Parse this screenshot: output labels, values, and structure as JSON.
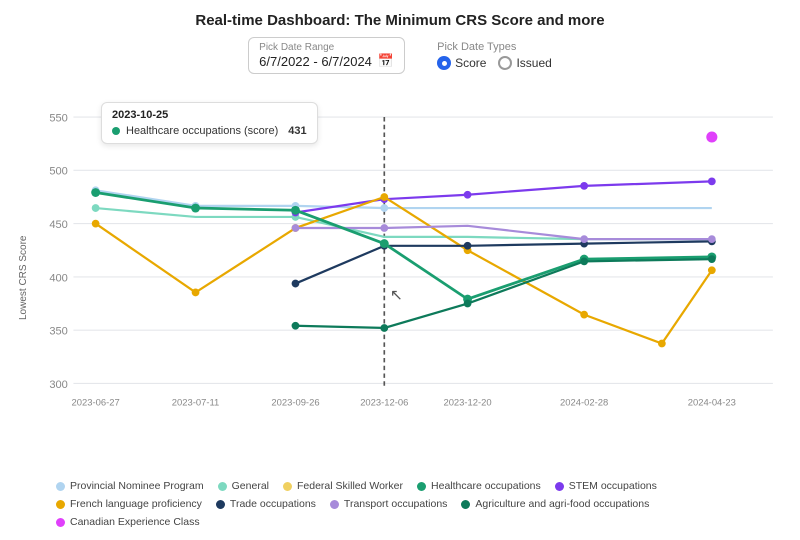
{
  "title": "Real-time Dashboard: The Minimum CRS Score and more",
  "controls": {
    "date_range_label": "Pick Date Range",
    "date_range_value": "6/7/2022 - 6/7/2024",
    "date_types_label": "Pick Date Types",
    "score_label": "Score",
    "issued_label": "Issued"
  },
  "chart": {
    "y_axis_label": "Lowest CRS Score",
    "y_ticks": [
      "550",
      "500",
      "450",
      "400",
      "350",
      "300"
    ],
    "x_ticks": [
      "2023-06-27",
      "2023-07-11",
      "2023-09-26",
      "2023-12-06",
      "2023-12-20",
      "2024-02-28",
      "2024-04-23"
    ],
    "tooltip": {
      "date": "2023-10-25",
      "item_label": "Healthcare occupations (score)",
      "item_value": "431"
    }
  },
  "legend": [
    {
      "label": "Provincial Nominee Program",
      "color": "#b0d4f0",
      "type": "dot"
    },
    {
      "label": "General",
      "color": "#7dd9c0",
      "type": "dot"
    },
    {
      "label": "Federal Skilled Worker",
      "color": "#f0d060",
      "type": "dot"
    },
    {
      "label": "Healthcare occupations",
      "color": "#1a9e70",
      "type": "dot"
    },
    {
      "label": "STEM occupations",
      "color": "#7c3aed",
      "type": "dot"
    },
    {
      "label": "French language proficiency",
      "color": "#e8a800",
      "type": "dot"
    },
    {
      "label": "Trade occupations",
      "color": "#1e3a5f",
      "type": "dot"
    },
    {
      "label": "Transport occupations",
      "color": "#a78bda",
      "type": "dot"
    },
    {
      "label": "Agriculture and agri-food occupations",
      "color": "#1a9e70",
      "type": "dot"
    },
    {
      "label": "Canadian Experience Class",
      "color": "#e040fb",
      "type": "dot"
    }
  ]
}
